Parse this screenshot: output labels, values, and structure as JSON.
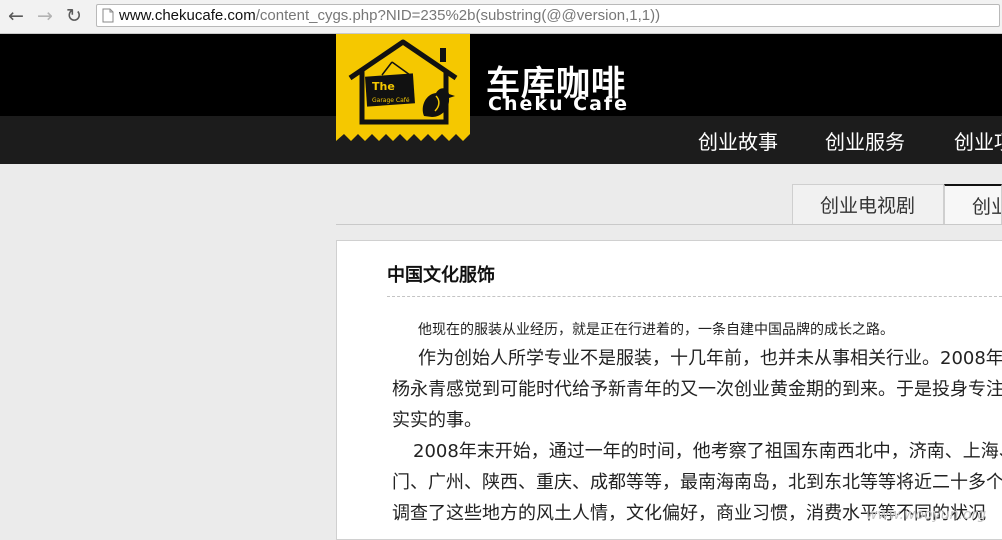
{
  "browser": {
    "url_host": "www.chekucafe.com",
    "url_path": "/content_cygs.php?NID=235%2b(substring(@@version,1,1))",
    "back_icon": "back-arrow-icon",
    "forward_icon": "forward-arrow-icon",
    "reload_icon": "reload-icon"
  },
  "site": {
    "brand_cn": "车库咖啡",
    "brand_en": "Cheku Cafe",
    "logo_sign_the": "The",
    "logo_sign_sub": "Garage Café",
    "nav": [
      "创业故事",
      "创业服务",
      "创业项"
    ]
  },
  "tabs": [
    "创业电视剧",
    "创业"
  ],
  "article": {
    "title": "中国文化服饰",
    "intro": "他现在的服装从业经历，就是正在行进着的，一条自建中国品牌的成长之路。",
    "paragraphs": [
      "作为创始人所学专业不是服装，十几年前，也并未从事相关行业。2008年",
      "杨永青感觉到可能时代给予新青年的又一次创业黄金期的到来。于是投身专注",
      "实实的事。",
      "2008年末开始，通过一年的时间，他考察了祖国东南西北中，济南、上海、",
      "门、广州、陕西、重庆、成都等等，最南海南岛，北到东北等等将近二十多个",
      "调查了这些地方的风土人情，文化偏好，商业习惯，消费水平等不同的状况"
    ]
  },
  "watermark": "www.wooyun.org",
  "colors": {
    "header_bg": "#000000",
    "nav_bg": "#1c1c1c",
    "logo_yellow": "#f5c800",
    "page_bg": "#ebebeb"
  }
}
